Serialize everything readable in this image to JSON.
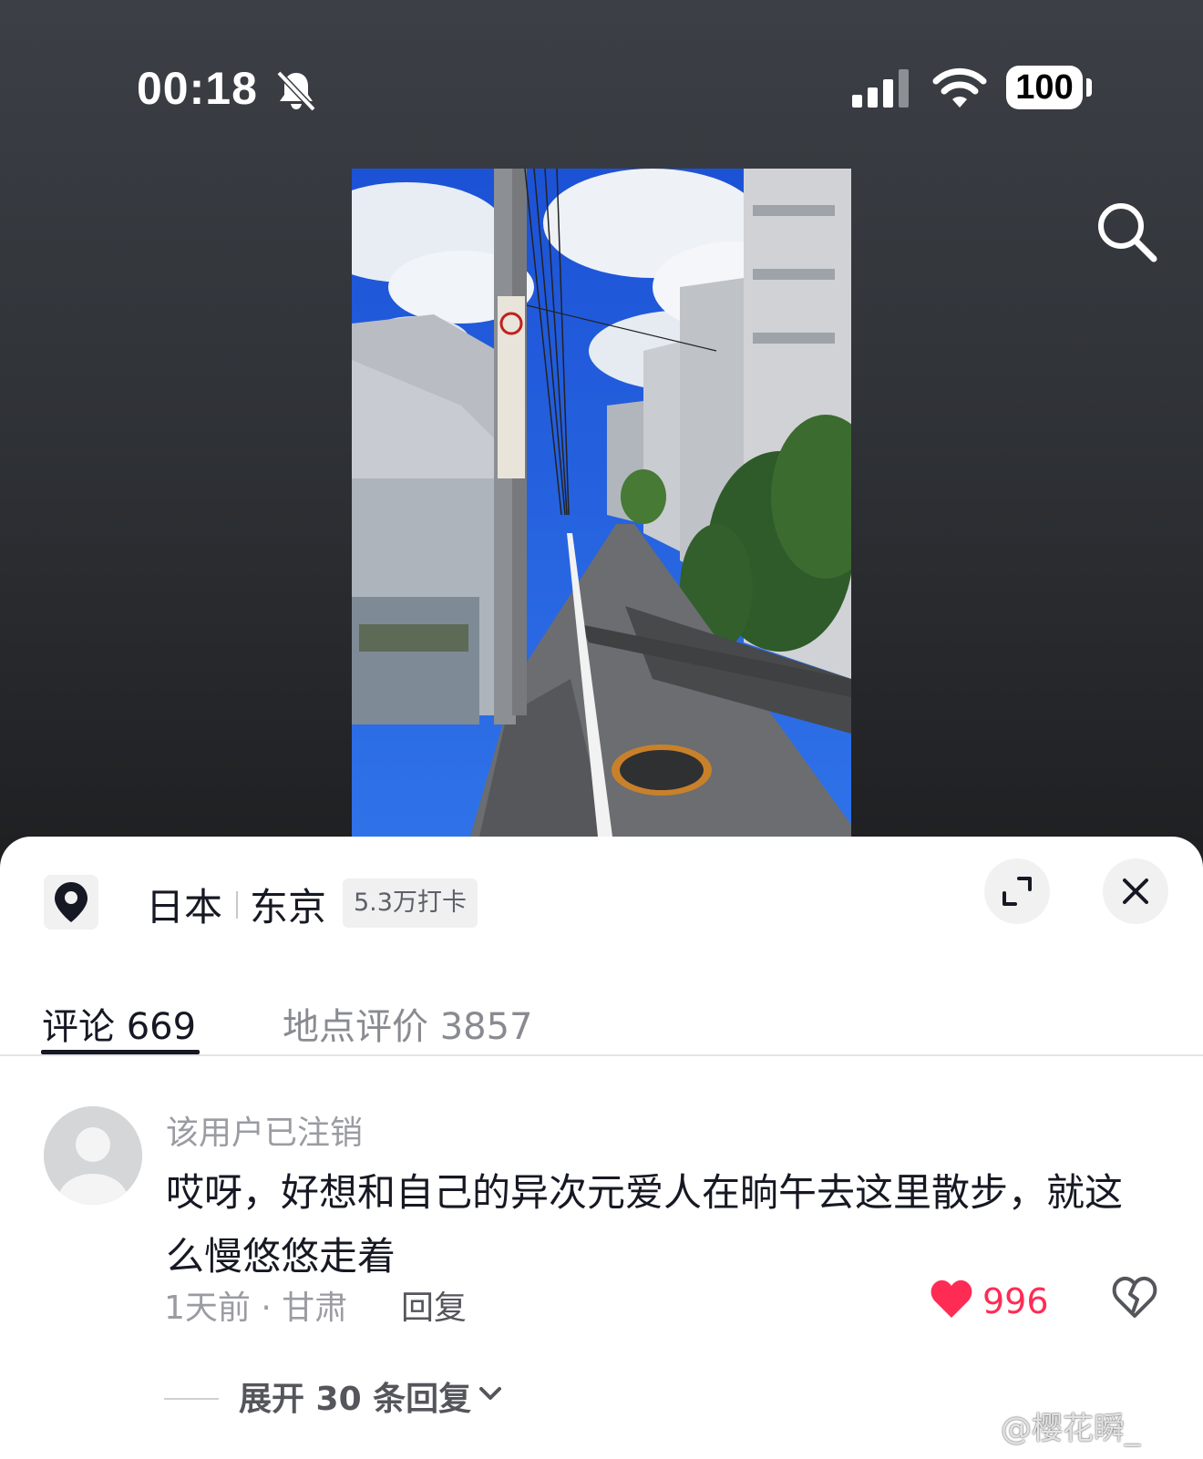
{
  "status_bar": {
    "time": "00:18",
    "battery": "100",
    "icons": [
      "bell-mute-icon",
      "cellular-signal-icon",
      "wifi-icon",
      "battery-icon"
    ]
  },
  "header": {
    "search_icon": "search-icon"
  },
  "location": {
    "country": "日本",
    "city": "东京",
    "checkin_count": "5.3万打卡",
    "icon": "map-pin-icon"
  },
  "actions": {
    "expand_icon": "expand-icon",
    "close_icon": "close-icon"
  },
  "tabs": [
    {
      "label": "评论 669",
      "active": true
    },
    {
      "label": "地点评价 3857",
      "active": false
    }
  ],
  "comment": {
    "username": "该用户已注销",
    "text": "哎呀，好想和自己的异次元爱人在晌午去这里散步，就这么慢悠悠走着",
    "meta": "1天前 · 甘肃",
    "reply_label": "回复",
    "like_count": "996",
    "expand_replies": "展开 30 条回复"
  },
  "watermark": "@樱花瞬_",
  "colors": {
    "accent": "#fe2c55",
    "text_primary": "#161823",
    "text_secondary": "#9b9ca2"
  }
}
